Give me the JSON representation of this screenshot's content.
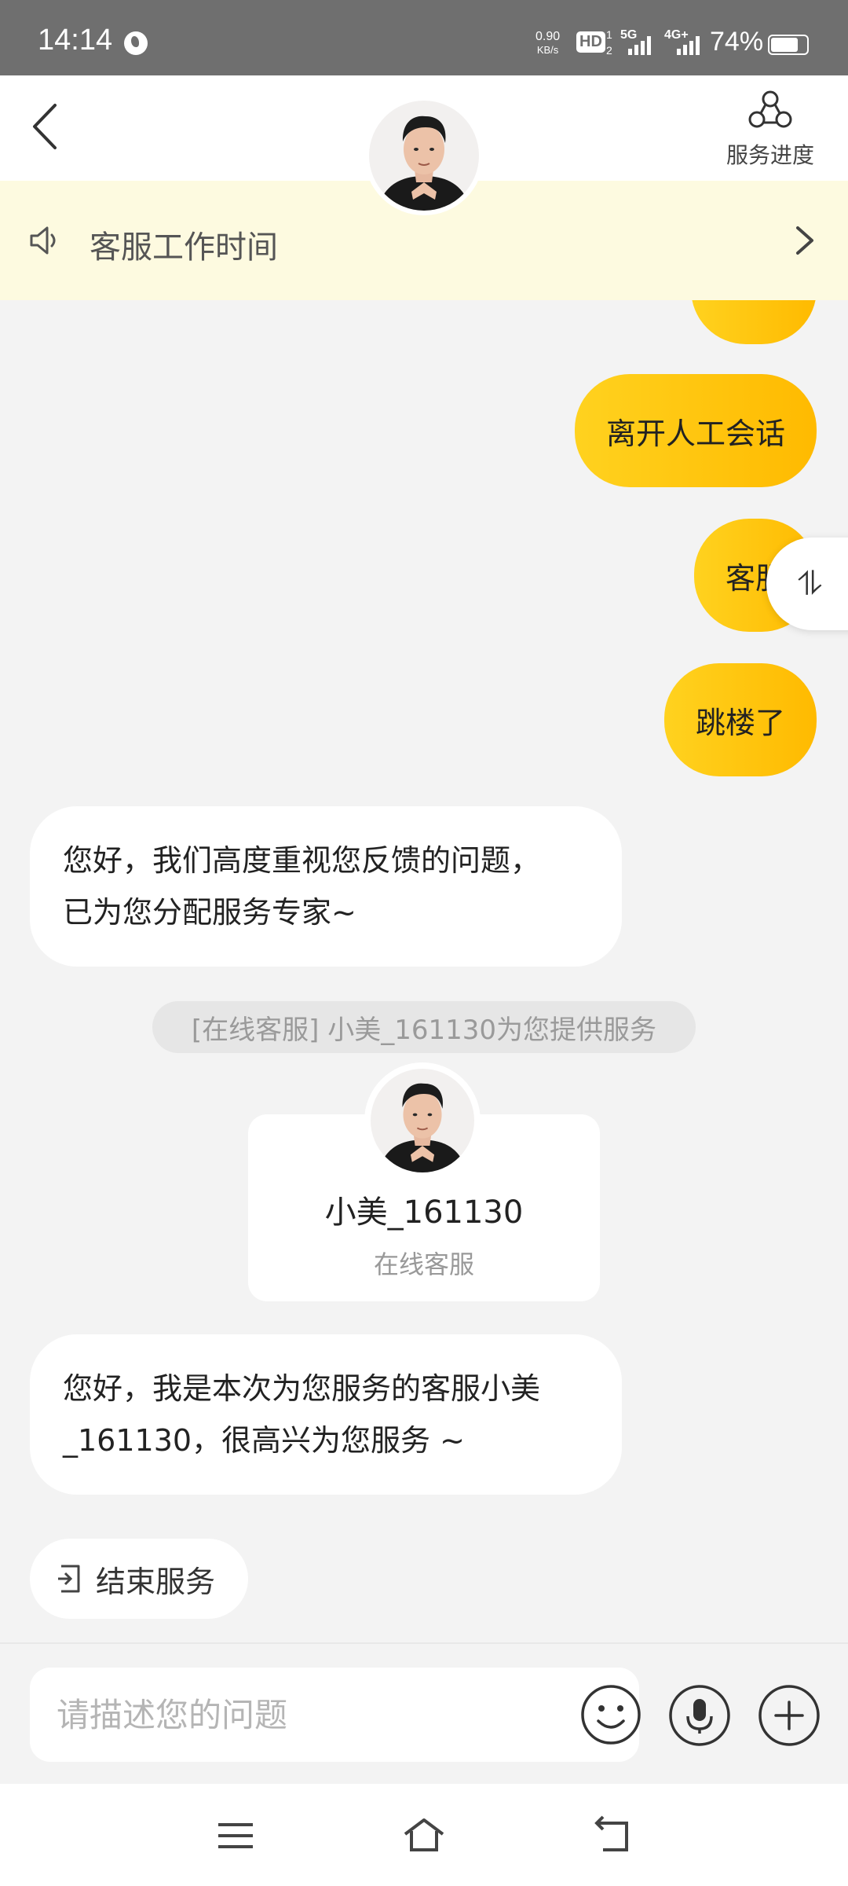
{
  "status_bar": {
    "time": "14:14",
    "net_speed_value": "0.90",
    "net_speed_unit": "KB/s",
    "hd_label": "HD",
    "hd_index": "1",
    "hd_index2": "2",
    "sim1_label": "5G",
    "sim2_label": "4G+",
    "battery_percent": "74%"
  },
  "header": {
    "back_icon": "chevron-left-icon",
    "service_progress_label": "服务进度",
    "service_progress_icon": "network-nodes-icon"
  },
  "notice": {
    "icon": "speaker-icon",
    "text": "客服工作时间"
  },
  "messages_outgoing": [
    {
      "text": "离开人工会话"
    },
    {
      "text": "客服"
    },
    {
      "text": "跳楼了"
    }
  ],
  "incoming_1": {
    "line1": "您好，我们高度重视您反馈的问题，",
    "line2": "已为您分配服务专家~"
  },
  "system_pill": "[在线客服] 小美_161130为您提供服务",
  "agent_card": {
    "name": "小美_161130",
    "role": "在线客服"
  },
  "incoming_2": {
    "line1": "您好，我是本次为您服务的客服小美",
    "line2": "_161130，很高兴为您服务 ~"
  },
  "end_service_label": "结束服务",
  "float_button_label": "⥮",
  "input": {
    "placeholder": "请描述您的问题",
    "value": ""
  },
  "colors": {
    "accent_yellow": "#ffc107",
    "notice_bg": "#fdfae0"
  }
}
